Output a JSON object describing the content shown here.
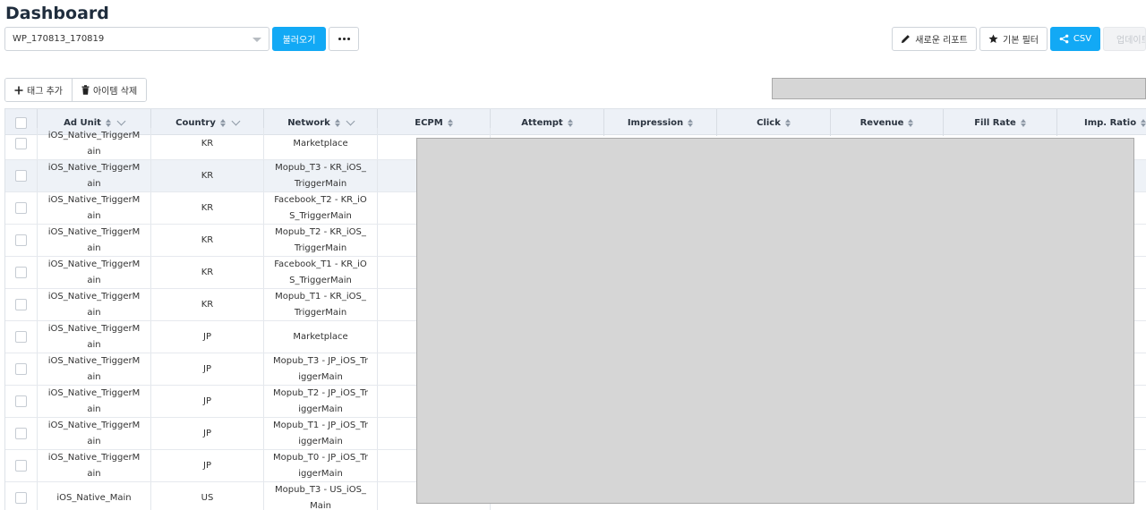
{
  "page": {
    "title": "Dashboard"
  },
  "toolbar": {
    "report_select": "WP_170813_170819",
    "load_button": "불러오기",
    "new_report_button": "새로운 리포트",
    "default_filter_button": "기본 필터",
    "csv_button": "CSV",
    "upload_button": "업데이트"
  },
  "actions": {
    "add_tag_button": "태그 추가",
    "delete_item_button": "아이템 삭제"
  },
  "columns": [
    "Ad Unit",
    "Country",
    "Network",
    "ECPM",
    "Attempt",
    "Impression",
    "Click",
    "Revenue",
    "Fill Rate",
    "Imp. Ratio"
  ],
  "rows": [
    {
      "ad_unit": "iOS_Native_TriggerMain",
      "country": "KR",
      "network": "Marketplace"
    },
    {
      "ad_unit": "iOS_Native_TriggerMain",
      "country": "KR",
      "network": "Mopub_T3 - KR_iOS_TriggerMain"
    },
    {
      "ad_unit": "iOS_Native_TriggerMain",
      "country": "KR",
      "network": "Facebook_T2 - KR_iOS_TriggerMain"
    },
    {
      "ad_unit": "iOS_Native_TriggerMain",
      "country": "KR",
      "network": "Mopub_T2 - KR_iOS_TriggerMain"
    },
    {
      "ad_unit": "iOS_Native_TriggerMain",
      "country": "KR",
      "network": "Facebook_T1 - KR_iOS_TriggerMain"
    },
    {
      "ad_unit": "iOS_Native_TriggerMain",
      "country": "KR",
      "network": "Mopub_T1 - KR_iOS_TriggerMain"
    },
    {
      "ad_unit": "iOS_Native_TriggerMain",
      "country": "JP",
      "network": "Marketplace"
    },
    {
      "ad_unit": "iOS_Native_TriggerMain",
      "country": "JP",
      "network": "Mopub_T3 - JP_iOS_TriggerMain"
    },
    {
      "ad_unit": "iOS_Native_TriggerMain",
      "country": "JP",
      "network": "Mopub_T2 - JP_iOS_TriggerMain"
    },
    {
      "ad_unit": "iOS_Native_TriggerMain",
      "country": "JP",
      "network": "Mopub_T1 - JP_iOS_TriggerMain"
    },
    {
      "ad_unit": "iOS_Native_TriggerMain",
      "country": "JP",
      "network": "Mopub_T0 - JP_iOS_TriggerMain"
    },
    {
      "ad_unit": "iOS_Native_Main",
      "country": "US",
      "network": "Mopub_T3 - US_iOS_Main"
    }
  ]
}
